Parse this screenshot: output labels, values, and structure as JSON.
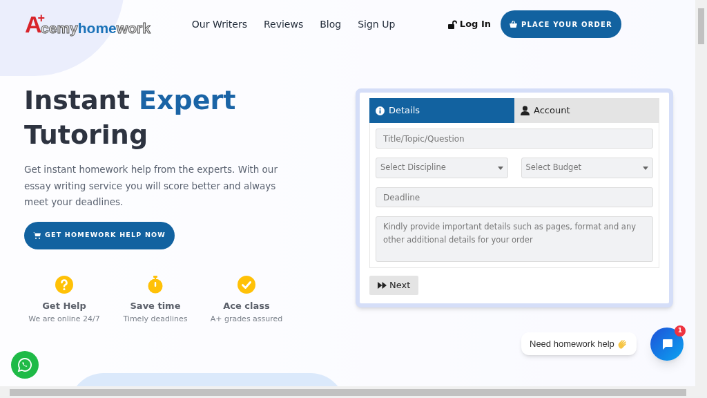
{
  "logo": {
    "mark": "A",
    "plus": "+",
    "parts": [
      {
        "text": "cemy",
        "kind": "plain"
      },
      {
        "text": "home",
        "kind": "accent"
      },
      {
        "text": "work",
        "kind": "plain"
      }
    ]
  },
  "nav": {
    "links": [
      "Our Writers",
      "Reviews",
      "Blog",
      "Sign Up"
    ],
    "login": "Log In",
    "order_button": "PLACE YOUR ORDER"
  },
  "hero": {
    "title": [
      {
        "text": "Instant ",
        "kind": "plain"
      },
      {
        "text": "Expert",
        "kind": "accent"
      },
      {
        "text": "Tutoring",
        "kind": "plain"
      }
    ],
    "lead": "Get instant homework help from the experts. With our essay writing service you will score better and always meet your deadlines.",
    "cta": "GET HOMEWORK HELP NOW"
  },
  "features": [
    {
      "kind": "question",
      "title": "Get Help",
      "subtitle": "We are online 24/7"
    },
    {
      "kind": "stopwatch",
      "title": "Save time",
      "subtitle": "Timely deadlines"
    },
    {
      "kind": "check",
      "title": "Ace class",
      "subtitle": "A+ grades assured"
    }
  ],
  "order_form": {
    "tabs": [
      {
        "label": "Details",
        "kind": "info",
        "selected": true
      },
      {
        "label": "Account",
        "kind": "user",
        "selected": false
      }
    ],
    "title_field": {
      "placeholder": "Title/Topic/Question"
    },
    "selects": [
      {
        "placeholder": "Select Discipline"
      },
      {
        "placeholder": "Select Budget"
      }
    ],
    "deadline_field": {
      "placeholder": "Deadline"
    },
    "details_field": {
      "placeholder": "Kindly provide important details such as pages, format and any other additional details for your order"
    },
    "next_button": "Next"
  },
  "chat": {
    "bubble": "Need homework help",
    "badge": "1"
  }
}
